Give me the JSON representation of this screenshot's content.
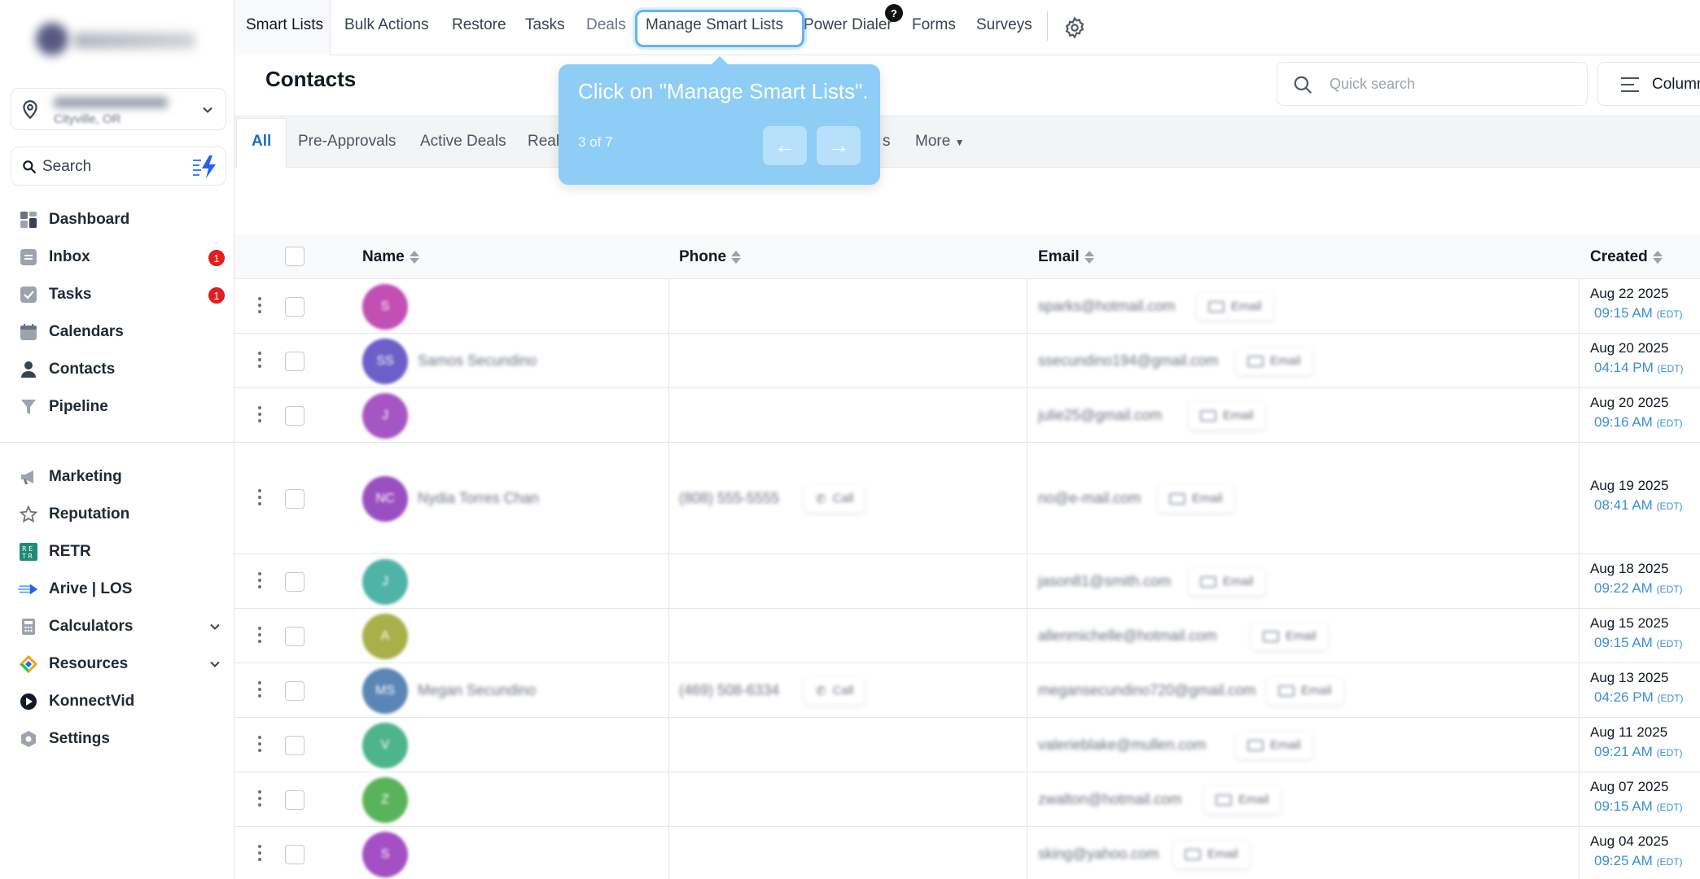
{
  "sidebar": {
    "location_subtitle": "Cityville, OR",
    "search_placeholder": "Search",
    "items": [
      {
        "label": "Dashboard",
        "icon": "dashboard-icon"
      },
      {
        "label": "Inbox",
        "icon": "inbox-icon",
        "badge": "1"
      },
      {
        "label": "Tasks",
        "icon": "tasks-icon",
        "badge": "1"
      },
      {
        "label": "Calendars",
        "icon": "calendar-icon"
      },
      {
        "label": "Contacts",
        "icon": "person-icon"
      },
      {
        "label": "Pipeline",
        "icon": "funnel-icon"
      },
      {
        "label": "Marketing",
        "icon": "megaphone-icon"
      },
      {
        "label": "Reputation",
        "icon": "star-icon"
      },
      {
        "label": "RETR",
        "icon": "retr-logo-icon"
      },
      {
        "label": "Arive | LOS",
        "icon": "arive-icon"
      },
      {
        "label": "Calculators",
        "icon": "calculator-icon"
      },
      {
        "label": "Resources",
        "icon": "resources-icon"
      },
      {
        "label": "KonnectVid",
        "icon": "play-icon"
      },
      {
        "label": "Settings",
        "icon": "settings-icon"
      }
    ]
  },
  "topnav": {
    "tabs": [
      "Smart Lists",
      "Bulk Actions",
      "Restore",
      "Tasks",
      "Deals",
      "Manage Smart Lists",
      "Power Dialer",
      "Forms",
      "Surveys"
    ],
    "help_badge": "?"
  },
  "header": {
    "title": "Contacts",
    "quick_search_placeholder": "Quick search",
    "columns_label": "Columns"
  },
  "smart_lists": {
    "tabs": [
      "All",
      "Pre-Approvals",
      "Active Deals",
      "Real",
      "s",
      "More"
    ]
  },
  "table": {
    "columns": [
      "Name",
      "Phone",
      "Email",
      "Created"
    ],
    "chip_email": "Email",
    "chip_call": "Call",
    "rows": [
      {
        "initials": "S",
        "name": "",
        "phone": "",
        "email": "sparks@hotmail.com",
        "date": "Aug 22 2025",
        "time": "09:15 AM",
        "tz": "(EDT)",
        "avatar_color": "#c24fb4"
      },
      {
        "initials": "SS",
        "name": "Samos Secundino",
        "phone": "",
        "email": "ssecundino194@gmail.com",
        "date": "Aug 20 2025",
        "time": "04:14 PM",
        "tz": "(EDT)",
        "avatar_color": "#6d5ec9"
      },
      {
        "initials": "J",
        "name": "",
        "phone": "",
        "email": "julie25@gmail.com",
        "date": "Aug 20 2025",
        "time": "09:16 AM",
        "tz": "(EDT)",
        "avatar_color": "#a655c4"
      },
      {
        "initials": "NC",
        "name": "Nydia Torres Chan",
        "phone": "(808) 555-5555",
        "email": "no@e-mail.com",
        "date": "Aug 19 2025",
        "time": "08:41 AM",
        "tz": "(EDT)",
        "avatar_color": "#9a4fc0"
      },
      {
        "initials": "J",
        "name": "",
        "phone": "",
        "email": "jason81@smith.com",
        "date": "Aug 18 2025",
        "time": "09:22 AM",
        "tz": "(EDT)",
        "avatar_color": "#4fb3a8"
      },
      {
        "initials": "A",
        "name": "",
        "phone": "",
        "email": "allenmichelle@hotmail.com",
        "date": "Aug 15 2025",
        "time": "09:15 AM",
        "tz": "(EDT)",
        "avatar_color": "#a8b04a"
      },
      {
        "initials": "MS",
        "name": "Megan Secundino",
        "phone": "(469) 508-6334",
        "email": "megansecundino720@gmail.com",
        "date": "Aug 13 2025",
        "time": "04:26 PM",
        "tz": "(EDT)",
        "avatar_color": "#5a86b6"
      },
      {
        "initials": "V",
        "name": "",
        "phone": "",
        "email": "valerieblake@mullen.com",
        "date": "Aug 11 2025",
        "time": "09:21 AM",
        "tz": "(EDT)",
        "avatar_color": "#4db48c"
      },
      {
        "initials": "Z",
        "name": "",
        "phone": "",
        "email": "zwalton@hotmail.com",
        "date": "Aug 07 2025",
        "time": "09:15 AM",
        "tz": "(EDT)",
        "avatar_color": "#59b35a"
      },
      {
        "initials": "S",
        "name": "",
        "phone": "",
        "email": "sking@yahoo.com",
        "date": "Aug 04 2025",
        "time": "09:25 AM",
        "tz": "(EDT)",
        "avatar_color": "#a44fc4"
      }
    ]
  },
  "tooltip": {
    "message": "Click on \"Manage Smart Lists\".",
    "step": "3 of 7"
  },
  "colors": {
    "accent": "#1d6fb8",
    "tooltip_bg": "#8ecdf6",
    "highlight_border": "#60b4f0",
    "badge": "#e11d1d"
  }
}
